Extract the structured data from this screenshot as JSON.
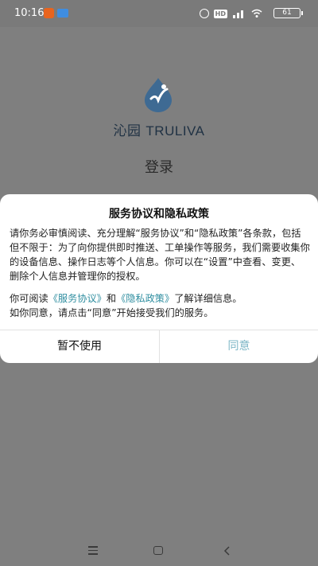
{
  "status_bar": {
    "time": "10:16",
    "hd_badge": "HD",
    "battery": "61",
    "icons": [
      "app-notification-icon",
      "app-notification-icon",
      "alarm-icon",
      "signal-icon",
      "wifi-icon",
      "battery-icon"
    ]
  },
  "page": {
    "logo_cn": "沁园",
    "logo_en": "TRULIVA",
    "login_title": "登录"
  },
  "dialog": {
    "title": "服务协议和隐私政策",
    "paragraph1": "请你务必审慎阅读、充分理解“服务协议”和“隐私政策”各条款，包括但不限于：为了向你提供即时推送、工单操作等服务，我们需要收集你的设备信息、操作日志等个人信息。你可以在“设置”中查看、变更、删除个人信息并管理你的授权。",
    "p2_prefix": "你可阅读",
    "service_link": "《服务协议》",
    "p2_and": "和",
    "privacy_link": "《隐私政策》",
    "p2_suffix": "了解详细信息。",
    "paragraph3": "如你同意，请点击“同意”开始接受我们的服务。",
    "decline_label": "暂不使用",
    "accept_label": "同意"
  },
  "nav_bar": {
    "icons": [
      "menu-icon",
      "home-icon",
      "back-icon"
    ]
  },
  "colors": {
    "overlay": "#7f7f7f",
    "link": "#2f8ea0",
    "accept_text": "#7fb7c7",
    "logo_drop": "#3e6a93"
  }
}
